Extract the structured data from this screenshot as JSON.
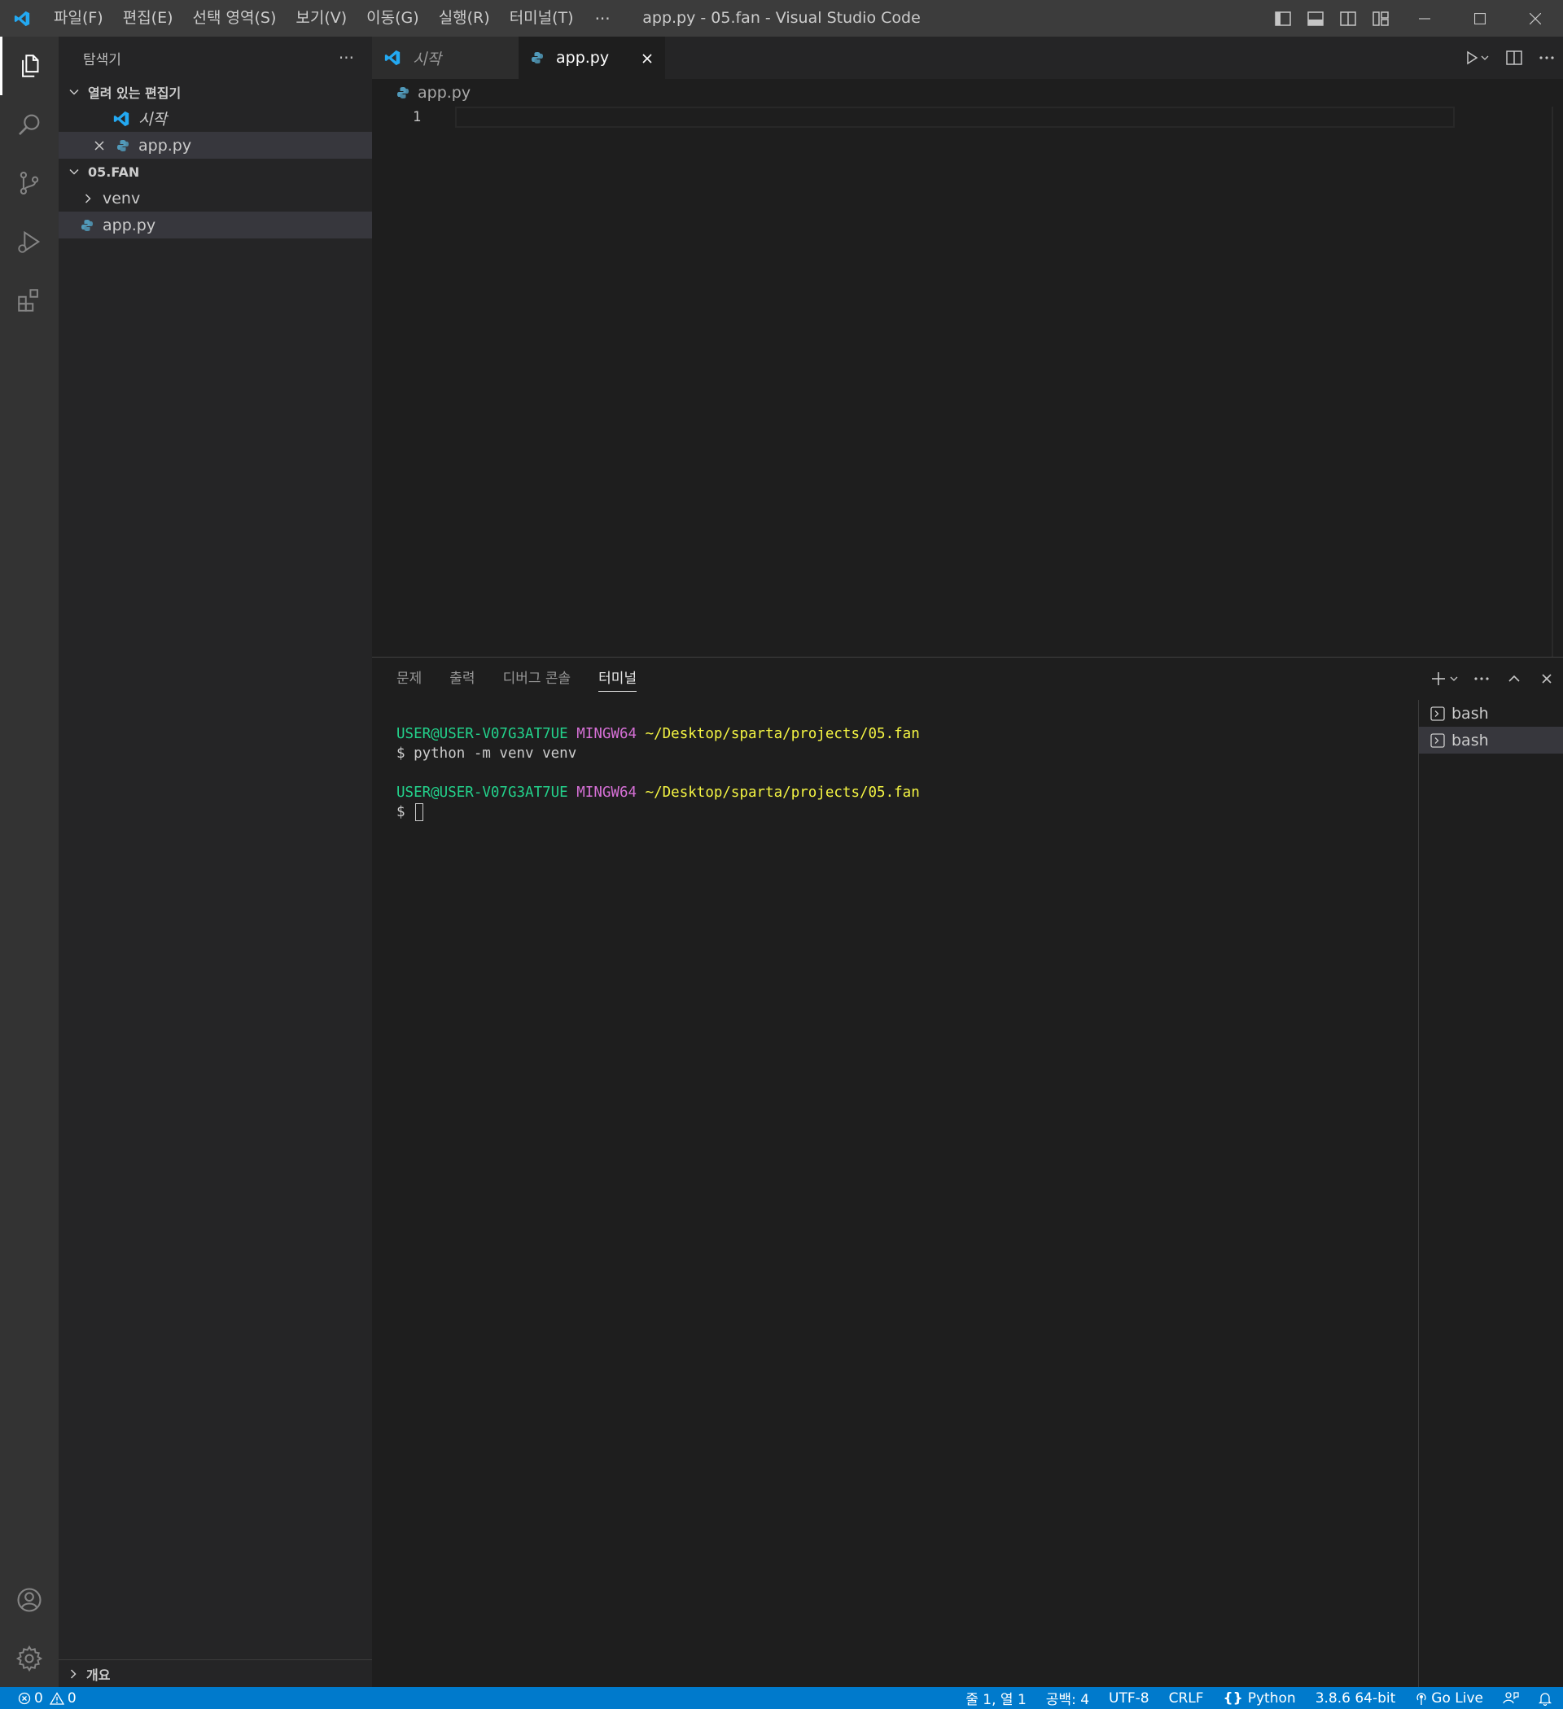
{
  "window": {
    "title": "app.py - 05.fan - Visual Studio Code",
    "menu": [
      "파일(F)",
      "편집(E)",
      "선택 영역(S)",
      "보기(V)",
      "이동(G)",
      "실행(R)",
      "터미널(T)"
    ],
    "menu_more": "···"
  },
  "sidebar": {
    "title": "탐색기",
    "more": "···",
    "open_editors": {
      "label": "열려 있는 편집기",
      "items": [
        {
          "label": "시작"
        },
        {
          "label": "app.py"
        }
      ]
    },
    "folder": {
      "label": "05.FAN",
      "items": [
        {
          "label": "venv"
        },
        {
          "label": "app.py"
        }
      ]
    },
    "outline": "개요"
  },
  "tabs": [
    {
      "label": "시작"
    },
    {
      "label": "app.py"
    }
  ],
  "editor": {
    "breadcrumb": "app.py",
    "line_number": "1"
  },
  "panel": {
    "tabs": [
      "문제",
      "출력",
      "디버그 콘솔",
      "터미널"
    ],
    "terminal": {
      "prompt1": {
        "user": "USER@USER-V07G3AT7UE",
        "sys": "MINGW64",
        "path": "~/Desktop/sparta/projects/05.fan"
      },
      "command1": "$ python -m venv venv",
      "prompt2": {
        "user": "USER@USER-V07G3AT7UE",
        "sys": "MINGW64",
        "path": "~/Desktop/sparta/projects/05.fan"
      },
      "command2": "$ "
    },
    "terminals": [
      "bash",
      "bash"
    ]
  },
  "statusbar": {
    "errors": "0",
    "warnings": "0",
    "position": "줄 1, 열 1",
    "spaces": "공백: 4",
    "encoding": "UTF-8",
    "eol": "CRLF",
    "language": "Python",
    "interpreter": "3.8.6 64-bit",
    "live": "Go Live"
  },
  "colors": {
    "statusbar": "#007acc",
    "activitybar": "#333333",
    "sidebar": "#252526",
    "editor": "#1e1e1e",
    "vscode_blue": "#23a9f2",
    "python_blue": "#519aba"
  }
}
